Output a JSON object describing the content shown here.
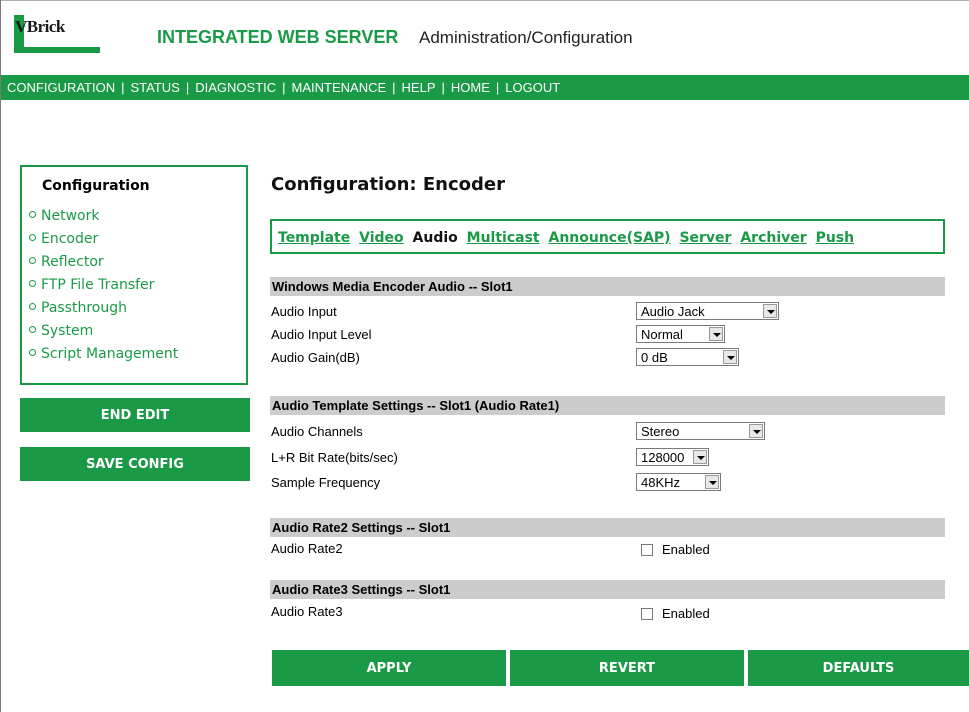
{
  "header": {
    "logo_text": "VBrick",
    "title": "INTEGRATED WEB SERVER",
    "subtitle": "Administration/Configuration"
  },
  "nav": {
    "items": [
      "CONFIGURATION",
      "STATUS",
      "DIAGNOSTIC",
      "MAINTENANCE",
      "HELP",
      "HOME",
      "LOGOUT"
    ],
    "separator": "|"
  },
  "sidebar": {
    "title": "Configuration",
    "items": [
      "Network",
      "Encoder",
      "Reflector",
      "FTP File Transfer",
      "Passthrough",
      "System",
      "Script Management"
    ],
    "end_edit": "END EDIT",
    "save_config": "SAVE CONFIG"
  },
  "main": {
    "title": "Configuration: Encoder",
    "tabs": [
      "Template",
      "Video",
      "Audio",
      "Multicast",
      "Announce(SAP)",
      "Server",
      "Archiver",
      "Push"
    ],
    "active_tab": "Audio",
    "sections": {
      "wme_audio": {
        "heading": "Windows Media Encoder Audio -- Slot1",
        "audio_input": {
          "label": "Audio Input",
          "value": "Audio Jack"
        },
        "audio_input_level": {
          "label": "Audio Input Level",
          "value": "Normal"
        },
        "audio_gain": {
          "label": "Audio Gain(dB)",
          "value": "0 dB"
        }
      },
      "template": {
        "heading": "Audio Template Settings -- Slot1 (Audio Rate1)",
        "channels": {
          "label": "Audio Channels",
          "value": "Stereo"
        },
        "bitrate": {
          "label": "L+R Bit Rate(bits/sec)",
          "value": "128000"
        },
        "sample_freq": {
          "label": "Sample Frequency",
          "value": "48KHz"
        }
      },
      "rate2": {
        "heading": "Audio Rate2 Settings -- Slot1",
        "label": "Audio Rate2",
        "checkbox_label": "Enabled"
      },
      "rate3": {
        "heading": "Audio Rate3 Settings -- Slot1",
        "label": "Audio Rate3",
        "checkbox_label": "Enabled"
      }
    },
    "buttons": {
      "apply": "APPLY",
      "revert": "REVERT",
      "defaults": "DEFAULTS"
    }
  },
  "colors": {
    "brand_green": "#1a9a47",
    "section_gray": "#cccccc"
  }
}
